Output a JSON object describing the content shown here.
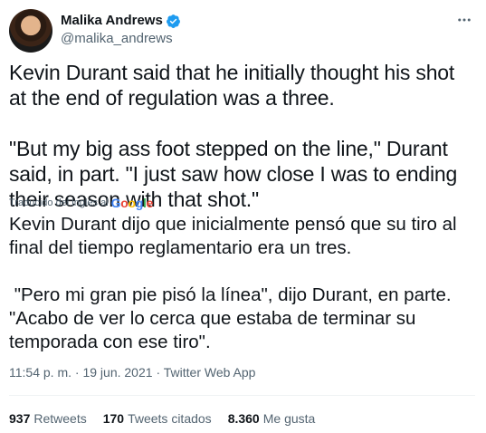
{
  "author": {
    "display_name": "Malika Andrews",
    "handle": "@malika_andrews",
    "verified": true,
    "verified_color": "#1d9bf0"
  },
  "tweet": {
    "text": "Kevin Durant said that he initially thought his shot at the end of regulation was a three.\n\n\"But my big ass foot stepped on the line,\" Durant said, in part. \"I just saw how close I was to ending their season with that shot.\"",
    "translation_label": "Traducido del inglés al",
    "translation_provider": "Google",
    "translated_text": "Kevin Durant dijo que inicialmente pensó que su tiro al final del tiempo reglamentario era un tres.\n\n \"Pero mi gran pie pisó la línea\", dijo Durant, en parte. \"Acabo de ver lo cerca que estaba de terminar su temporada con ese tiro\".",
    "time": "11:54 p. m.",
    "separator": "·",
    "date": "19 jun. 2021",
    "source": "Twitter Web App"
  },
  "stats": {
    "retweets_count": "937",
    "retweets_label": "Retweets",
    "quotes_count": "170",
    "quotes_label": "Tweets citados",
    "likes_count": "8.360",
    "likes_label": "Me gusta"
  },
  "icons": {
    "more": "more-icon",
    "verified": "verified-badge-icon"
  }
}
